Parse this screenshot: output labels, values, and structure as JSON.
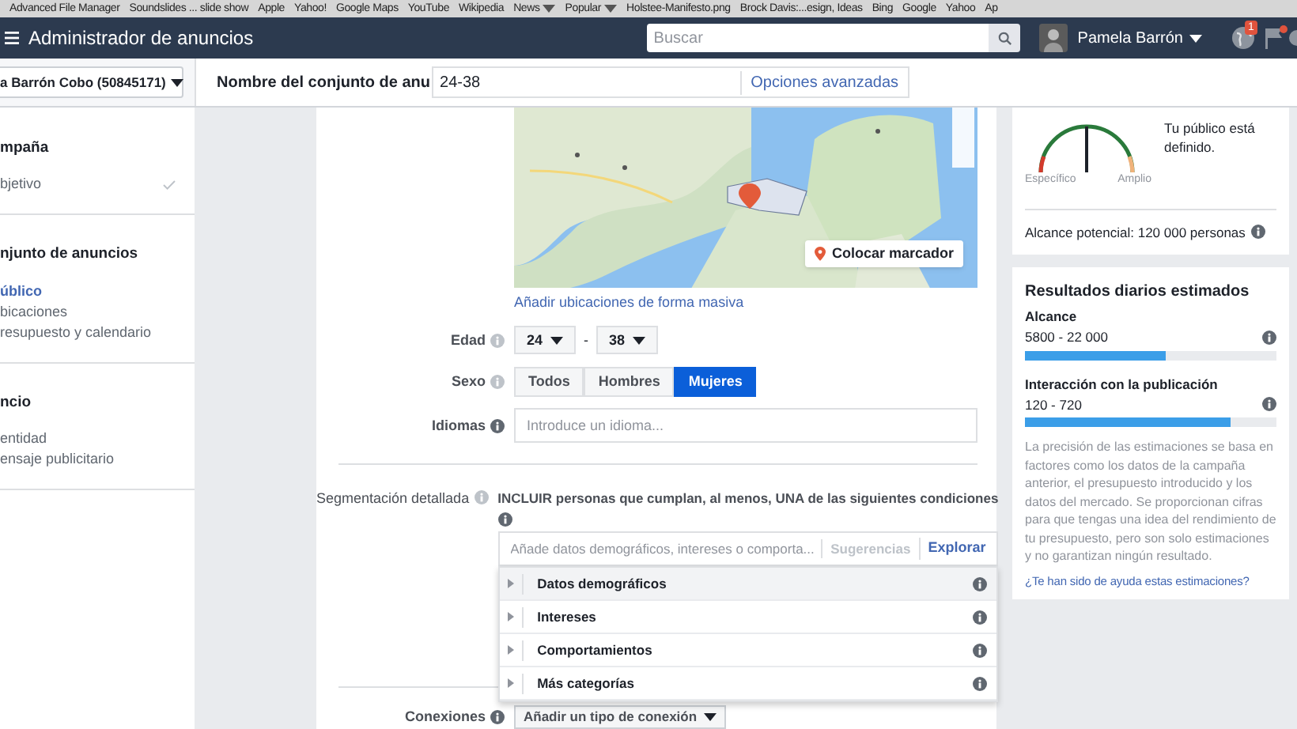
{
  "bookmarks": [
    {
      "label": "Advanced File Manager",
      "menu": false
    },
    {
      "label": "Soundslides ... slide show",
      "menu": false
    },
    {
      "label": "Apple",
      "menu": false
    },
    {
      "label": "Yahoo!",
      "menu": false
    },
    {
      "label": "Google Maps",
      "menu": false
    },
    {
      "label": "YouTube",
      "menu": false
    },
    {
      "label": "Wikipedia",
      "menu": false
    },
    {
      "label": "News",
      "menu": true
    },
    {
      "label": "Popular",
      "menu": true
    },
    {
      "label": "Holstee-Manifesto.png",
      "menu": false
    },
    {
      "label": "Brock Davis:...esign, Ideas",
      "menu": false
    },
    {
      "label": "Bing",
      "menu": false
    },
    {
      "label": "Google",
      "menu": false
    },
    {
      "label": "Yahoo",
      "menu": false
    },
    {
      "label": "Ap",
      "menu": false
    }
  ],
  "header": {
    "title": "Administrador de anuncios",
    "search": {
      "placeholder": "Buscar"
    },
    "user": "Pamela Barrón",
    "notifications": "1"
  },
  "account": "a Barrón Cobo (50845171)",
  "name_field": {
    "label": "Nombre del conjunto de anu",
    "value": "24-38",
    "link": "Opciones avanzadas"
  },
  "sidebar": [
    {
      "title": "mpaña",
      "items": [
        {
          "label": "bjetivo",
          "selected": false,
          "completed": true
        }
      ]
    },
    {
      "title": "njunto de anuncios",
      "items": [
        {
          "label": "úblico",
          "selected": true,
          "completed": false
        },
        {
          "label": "bicaciones",
          "selected": false,
          "completed": false
        },
        {
          "label": "resupuesto y calendario",
          "selected": false,
          "completed": false
        }
      ]
    },
    {
      "title": "ncio",
      "items": [
        {
          "label": "entidad",
          "selected": false,
          "completed": false
        },
        {
          "label": "ensaje publicitario",
          "selected": false,
          "completed": false
        }
      ]
    }
  ],
  "map": {
    "marker_button": "Colocar marcador",
    "bulk_link": "Añadir ubicaciones de forma masiva"
  },
  "age": {
    "label": "Edad",
    "from": "24",
    "separator": "-",
    "to": "38"
  },
  "gender": {
    "label": "Sexo",
    "options": [
      {
        "label": "Todos",
        "selected": false
      },
      {
        "label": "Hombres",
        "selected": false
      },
      {
        "label": "Mujeres",
        "selected": true
      }
    ]
  },
  "languages": {
    "label": "Idiomas",
    "placeholder": "Introduce un idioma..."
  },
  "detailed": {
    "label": "Segmentación detallada",
    "condition": "INCLUIR personas que cumplan, al menos, UNA de las siguientes condiciones",
    "placeholder": "Añade datos demográficos, intereses o comporta...",
    "suggestions": "Sugerencias",
    "browse": "Explorar",
    "categories": [
      {
        "label": "Datos demográficos",
        "selected": true
      },
      {
        "label": "Intereses",
        "selected": false
      },
      {
        "label": "Comportamientos",
        "selected": false
      },
      {
        "label": "Más categorías",
        "selected": false
      }
    ]
  },
  "connections": {
    "label": "Conexiones",
    "button": "Añadir un tipo de conexión"
  },
  "audience": {
    "specific": "Específico",
    "broad": "Amplio",
    "status": "Tu público está definido.",
    "reach": "Alcance potencial: 120 000 personas"
  },
  "estimates": {
    "title": "Resultados diarios estimados",
    "metrics": [
      {
        "name": "Alcance",
        "range": "5800 - 22 000",
        "level": 0.56
      },
      {
        "name": "Interacción con la publicación",
        "range": "120 - 720",
        "level": 0.82
      }
    ],
    "note": "La precisión de las estimaciones se basa en factores como los datos de la campaña anterior, el presupuesto introducido y los datos del mercado. Se proporcionan cifras para que tengas una idea del rendimiento de tu presupuesto, pero son solo estimaciones y no garantizan ningún resultado.",
    "help_link": "¿Te han sido de ayuda estas estimaciones?"
  }
}
